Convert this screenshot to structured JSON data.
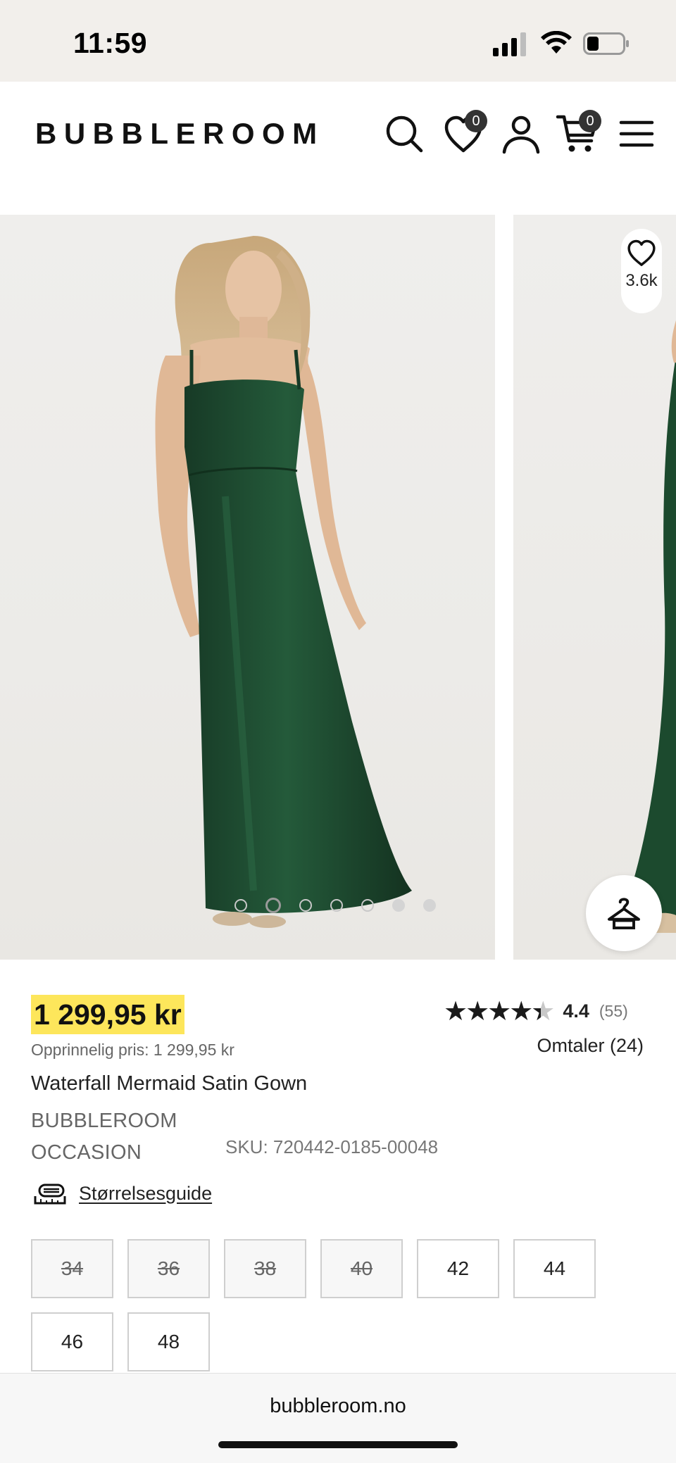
{
  "status_bar": {
    "time": "11:59"
  },
  "header": {
    "logo": "BUBBLEROOM",
    "wishlist_count": "0",
    "cart_count": "0"
  },
  "gallery": {
    "image_count": 7,
    "active_index": 1,
    "favorite_count": "3.6k"
  },
  "product": {
    "price": "1 299,95 kr",
    "original_price": "Opprinnelig pris: 1 299,95 kr",
    "title": "Waterfall Mermaid Satin Gown",
    "brand": "BUBBLEROOM OCCASION",
    "sku": "SKU: 720442-0185-00048",
    "rating": {
      "value": "4.4",
      "count": "(55)",
      "stars": 4.4
    },
    "reviews_link": "Omtaler (24)",
    "size_guide": "Størrelsesguide",
    "sizes": [
      {
        "label": "34",
        "available": false
      },
      {
        "label": "36",
        "available": false
      },
      {
        "label": "38",
        "available": false
      },
      {
        "label": "40",
        "available": false
      },
      {
        "label": "42",
        "available": true
      },
      {
        "label": "44",
        "available": true
      },
      {
        "label": "46",
        "available": true
      },
      {
        "label": "48",
        "available": true
      }
    ]
  },
  "browser": {
    "url": "bubbleroom.no"
  },
  "colors": {
    "price_highlight": "#fde65b",
    "dress": "#1f4a30",
    "badge": "#333333"
  }
}
